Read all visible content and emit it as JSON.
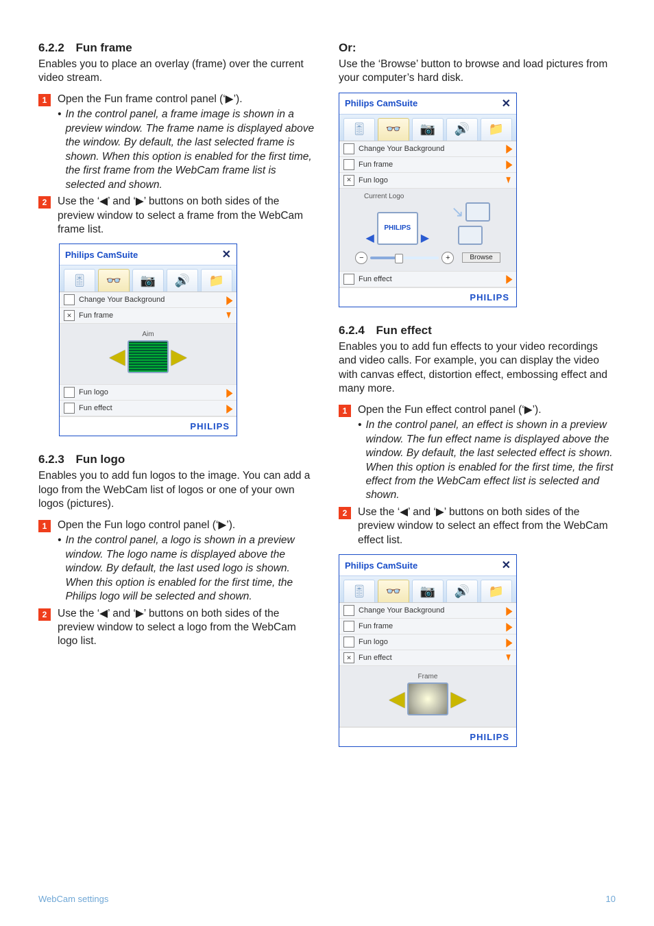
{
  "sections": {
    "s622": {
      "num": "6.2.2",
      "title": "Fun frame",
      "intro": "Enables you to place an overlay (frame) over the current video stream.",
      "step1": "Open the Fun frame control panel (‘▶’).",
      "step1_bullet": "In the control panel, a frame image is shown in a preview window.  The frame name is displayed above the window.  By default, the last selected frame is shown.  When this option is enabled for the first time, the first frame from the WebCam frame list is selected and shown.",
      "step2": "Use the ‘◀’ and ‘▶’ buttons on both sides of the preview window to select a frame from the WebCam frame list."
    },
    "s623": {
      "num": "6.2.3",
      "title": "Fun logo",
      "intro": "Enables you to add fun logos to the image.  You can add a logo from the WebCam list of logos or one of your own logos (pictures).",
      "step1": "Open the Fun logo control panel (‘▶’).",
      "step1_bullet": "In the control panel, a logo is shown in a preview window.  The logo name is displayed above the window. By default, the last used logo is shown.  When this option is enabled for the first time, the Philips logo will be selected and shown.",
      "step2": "Use the ‘◀’ and ‘▶’ buttons on both sides of the preview window to select a logo from the WebCam logo list."
    },
    "or_heading": "Or:",
    "or_text": "Use the ‘Browse’ button to browse and load pictures from your computer’s hard disk.",
    "s624": {
      "num": "6.2.4",
      "title": "Fun effect",
      "intro": "Enables you to add fun effects to your video recordings and video calls. For example, you can display the video with canvas effect, distortion effect, embossing effect and many more.",
      "step1": "Open the Fun effect control panel (‘▶’).",
      "step1_bullet": "In the control panel, an effect is shown in a preview window.  The fun effect name is displayed above the window. By default, the last selected effect is shown.  When this option is enabled for the first time, the first effect from the WebCam effect list is selected and shown.",
      "step2": "Use the ‘◀’ and ‘▶’ buttons on both sides of the preview window to select an effect from the WebCam effect list."
    }
  },
  "panel": {
    "title": "Philips CamSuite",
    "close": "✕",
    "rows": {
      "changebg": "Change Your Background",
      "funframe": "Fun frame",
      "funlogo": "Fun logo",
      "funeffect": "Fun effect"
    },
    "preview": {
      "aim": "Aim",
      "currentLogo": "Current Logo",
      "browse": "Browse",
      "philips": "PHILIPS",
      "frame": "Frame"
    },
    "brand": "PHILIPS"
  },
  "steps": {
    "n1": "1",
    "n2": "2"
  },
  "footer": {
    "section": "WebCam settings",
    "page": "10"
  }
}
